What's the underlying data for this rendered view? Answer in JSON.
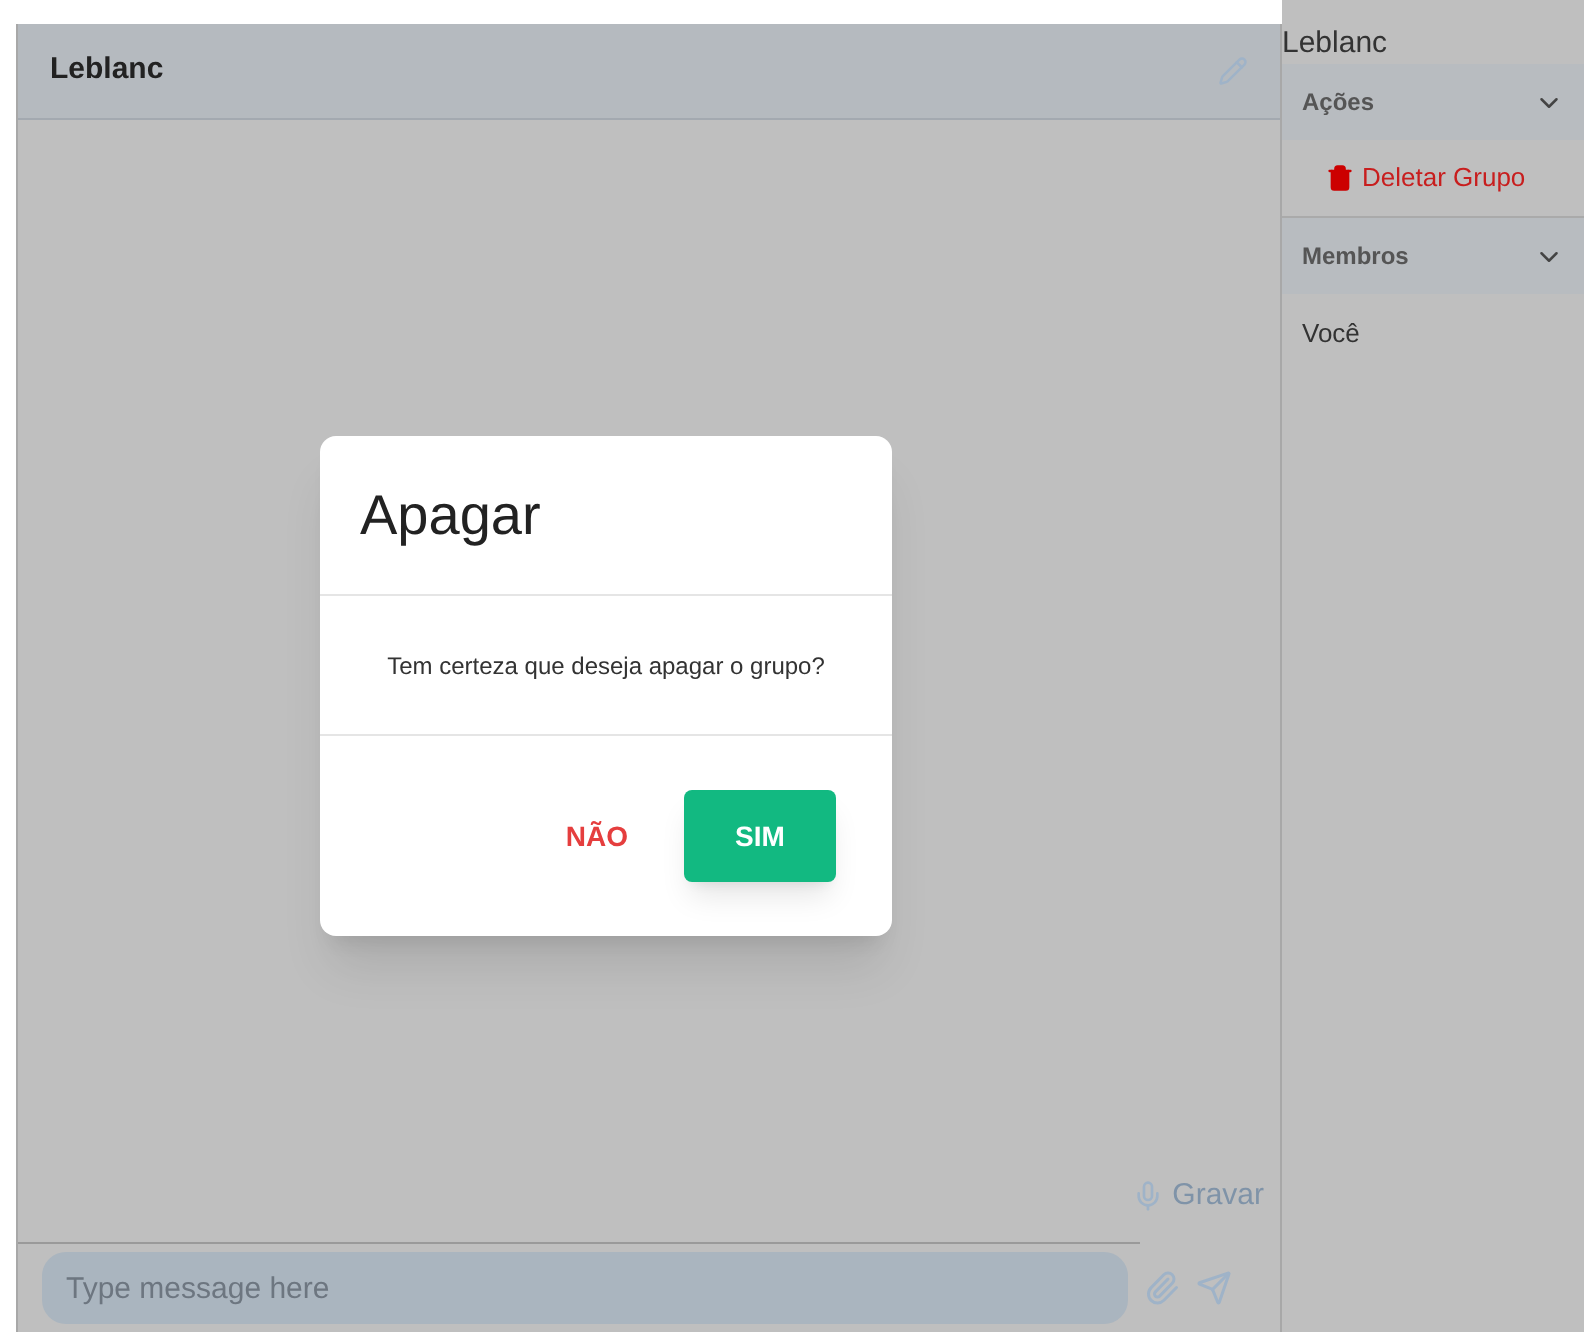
{
  "chat": {
    "title": "Leblanc",
    "record_label": "Gravar",
    "message_placeholder": "Type message here"
  },
  "sidebar": {
    "title": "Leblanc",
    "sections": [
      {
        "title": "Ações",
        "expanded": true,
        "items": [
          {
            "kind": "danger",
            "label": "Deletar Grupo"
          }
        ]
      },
      {
        "title": "Membros",
        "expanded": true,
        "items": [
          {
            "kind": "member",
            "label": "Você"
          }
        ]
      }
    ]
  },
  "dialog": {
    "title": "Apagar",
    "message": "Tem certeza que deseja apagar o grupo?",
    "buttons": [
      {
        "kind": "cancel",
        "label": "NÃO"
      },
      {
        "kind": "confirm",
        "label": "SIM"
      }
    ]
  }
}
